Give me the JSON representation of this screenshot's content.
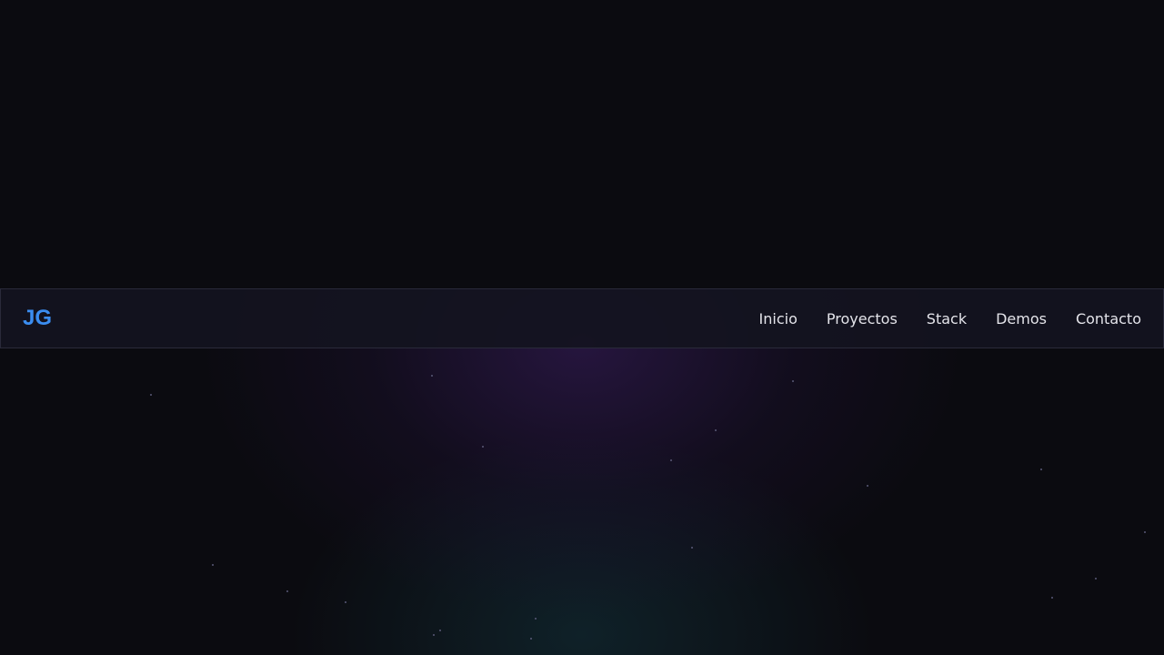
{
  "nav": {
    "logo_text": "JG",
    "links": [
      "Inicio",
      "Proyectos",
      "Stack",
      "Demos",
      "Contacto"
    ]
  },
  "colors": {
    "background": "#0b0b10",
    "accent": "#3b8df0",
    "nav_text": "#e4e4ea"
  }
}
